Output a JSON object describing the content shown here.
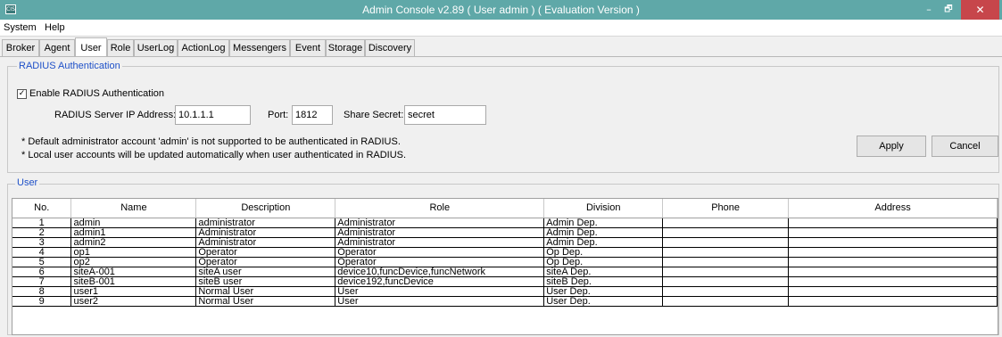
{
  "window": {
    "icon_label": "CIS",
    "title": "Admin Console v2.89 ( User admin ) ( Evaluation Version )",
    "minimize_glyph": "–",
    "maximize_glyph": "🗗",
    "close_glyph": "✕"
  },
  "menu": [
    "System",
    "Help"
  ],
  "tabs": [
    "Broker",
    "Agent",
    "User",
    "Role",
    "UserLog",
    "ActionLog",
    "Messengers",
    "Event",
    "Storage",
    "Discovery"
  ],
  "active_tab": "User",
  "radius": {
    "group_title": "RADIUS Authentication",
    "enable_label": "Enable RADIUS Authentication",
    "enable_checked": true,
    "check_glyph": "✓",
    "server_ip_label": "RADIUS Server IP Address:",
    "server_ip_value": "10.1.1.1",
    "port_label": "Port:",
    "port_value": "1812",
    "secret_label": "Share Secret:",
    "secret_value": "secret",
    "note1": "* Default administrator account 'admin' is not supported to be authenticated in RADIUS.",
    "note2": "* Local user accounts will be updated automatically when user authenticated in RADIUS.",
    "apply_label": "Apply",
    "cancel_label": "Cancel"
  },
  "users": {
    "group_title": "User",
    "columns": [
      "No.",
      "Name",
      "Description",
      "Role",
      "Division",
      "Phone",
      "Address"
    ],
    "rows": [
      [
        "1",
        "admin",
        "administrator",
        "Administrator",
        "Admin Dep.",
        "",
        ""
      ],
      [
        "2",
        "admin1",
        "Administrator",
        "Administrator",
        "Admin Dep.",
        "",
        ""
      ],
      [
        "3",
        "admin2",
        "Administrator",
        "Administrator",
        "Admin Dep.",
        "",
        ""
      ],
      [
        "4",
        "op1",
        "Operator",
        "Operator",
        "Op Dep.",
        "",
        ""
      ],
      [
        "5",
        "op2",
        "Operator",
        "Operator",
        "Op Dep.",
        "",
        ""
      ],
      [
        "6",
        "siteA-001",
        "siteA user",
        "device10,funcDevice,funcNetwork",
        "siteA Dep.",
        "",
        ""
      ],
      [
        "7",
        "siteB-001",
        "siteB user",
        "device192,funcDevice",
        "siteB Dep.",
        "",
        ""
      ],
      [
        "8",
        "user1",
        "Normal User",
        "User",
        "User Dep.",
        "",
        ""
      ],
      [
        "9",
        "user2",
        "Normal User",
        "User",
        "User Dep.",
        "",
        ""
      ]
    ]
  },
  "colors": {
    "titlebar": "#5fa8a8",
    "close_button": "#c7464b",
    "group_title": "#1e50c8"
  }
}
